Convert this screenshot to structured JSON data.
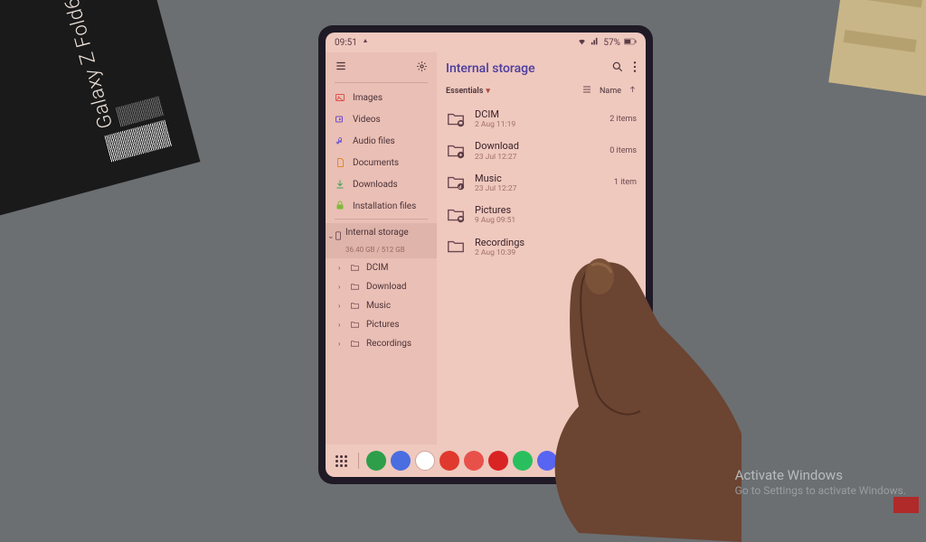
{
  "product_box_label": "Galaxy Z Fold6",
  "status": {
    "time": "09:51",
    "battery": "57%"
  },
  "sidebar": {
    "categories": [
      {
        "label": "Images",
        "color": "#d9534f"
      },
      {
        "label": "Videos",
        "color": "#6a49c9"
      },
      {
        "label": "Audio files",
        "color": "#7a5fd1"
      },
      {
        "label": "Documents",
        "color": "#e28a2b"
      },
      {
        "label": "Downloads",
        "color": "#3aa655"
      },
      {
        "label": "Installation files",
        "color": "#7fba3a"
      }
    ],
    "storage": {
      "label": "Internal storage",
      "sub": "36.40 GB / 512 GB"
    },
    "folders": [
      {
        "label": "DCIM"
      },
      {
        "label": "Download"
      },
      {
        "label": "Music"
      },
      {
        "label": "Pictures"
      },
      {
        "label": "Recordings"
      }
    ]
  },
  "main": {
    "title": "Internal storage",
    "filter_label": "Essentials",
    "sort_label": "Name",
    "folders": [
      {
        "name": "DCIM",
        "date": "2 Aug 11:19",
        "count": "2 items"
      },
      {
        "name": "Download",
        "date": "23 Jul 12:27",
        "count": "0 items"
      },
      {
        "name": "Music",
        "date": "23 Jul 12:27",
        "count": "1 item"
      },
      {
        "name": "Pictures",
        "date": "9 Aug 09:51",
        "count": ""
      },
      {
        "name": "Recordings",
        "date": "2 Aug 10:39",
        "count": ""
      }
    ]
  },
  "dock": {
    "apps": [
      {
        "name": "phone",
        "bg": "#2e9e4a"
      },
      {
        "name": "browser",
        "bg": "#4a6ee0"
      },
      {
        "name": "google",
        "bg": "#ffffff"
      },
      {
        "name": "flipboard",
        "bg": "#e03a2e"
      },
      {
        "name": "app-a",
        "bg": "#e8514a"
      },
      {
        "name": "youtube",
        "bg": "#d92424"
      },
      {
        "name": "whatsapp",
        "bg": "#2abf5e"
      },
      {
        "name": "discord",
        "bg": "#5865f2"
      },
      {
        "name": "app-b",
        "bg": "#3a7bd5"
      },
      {
        "name": "settings",
        "bg": "#3a3a3a"
      }
    ]
  },
  "watermark": {
    "title": "Activate Windows",
    "sub": "Go to Settings to activate Windows."
  }
}
